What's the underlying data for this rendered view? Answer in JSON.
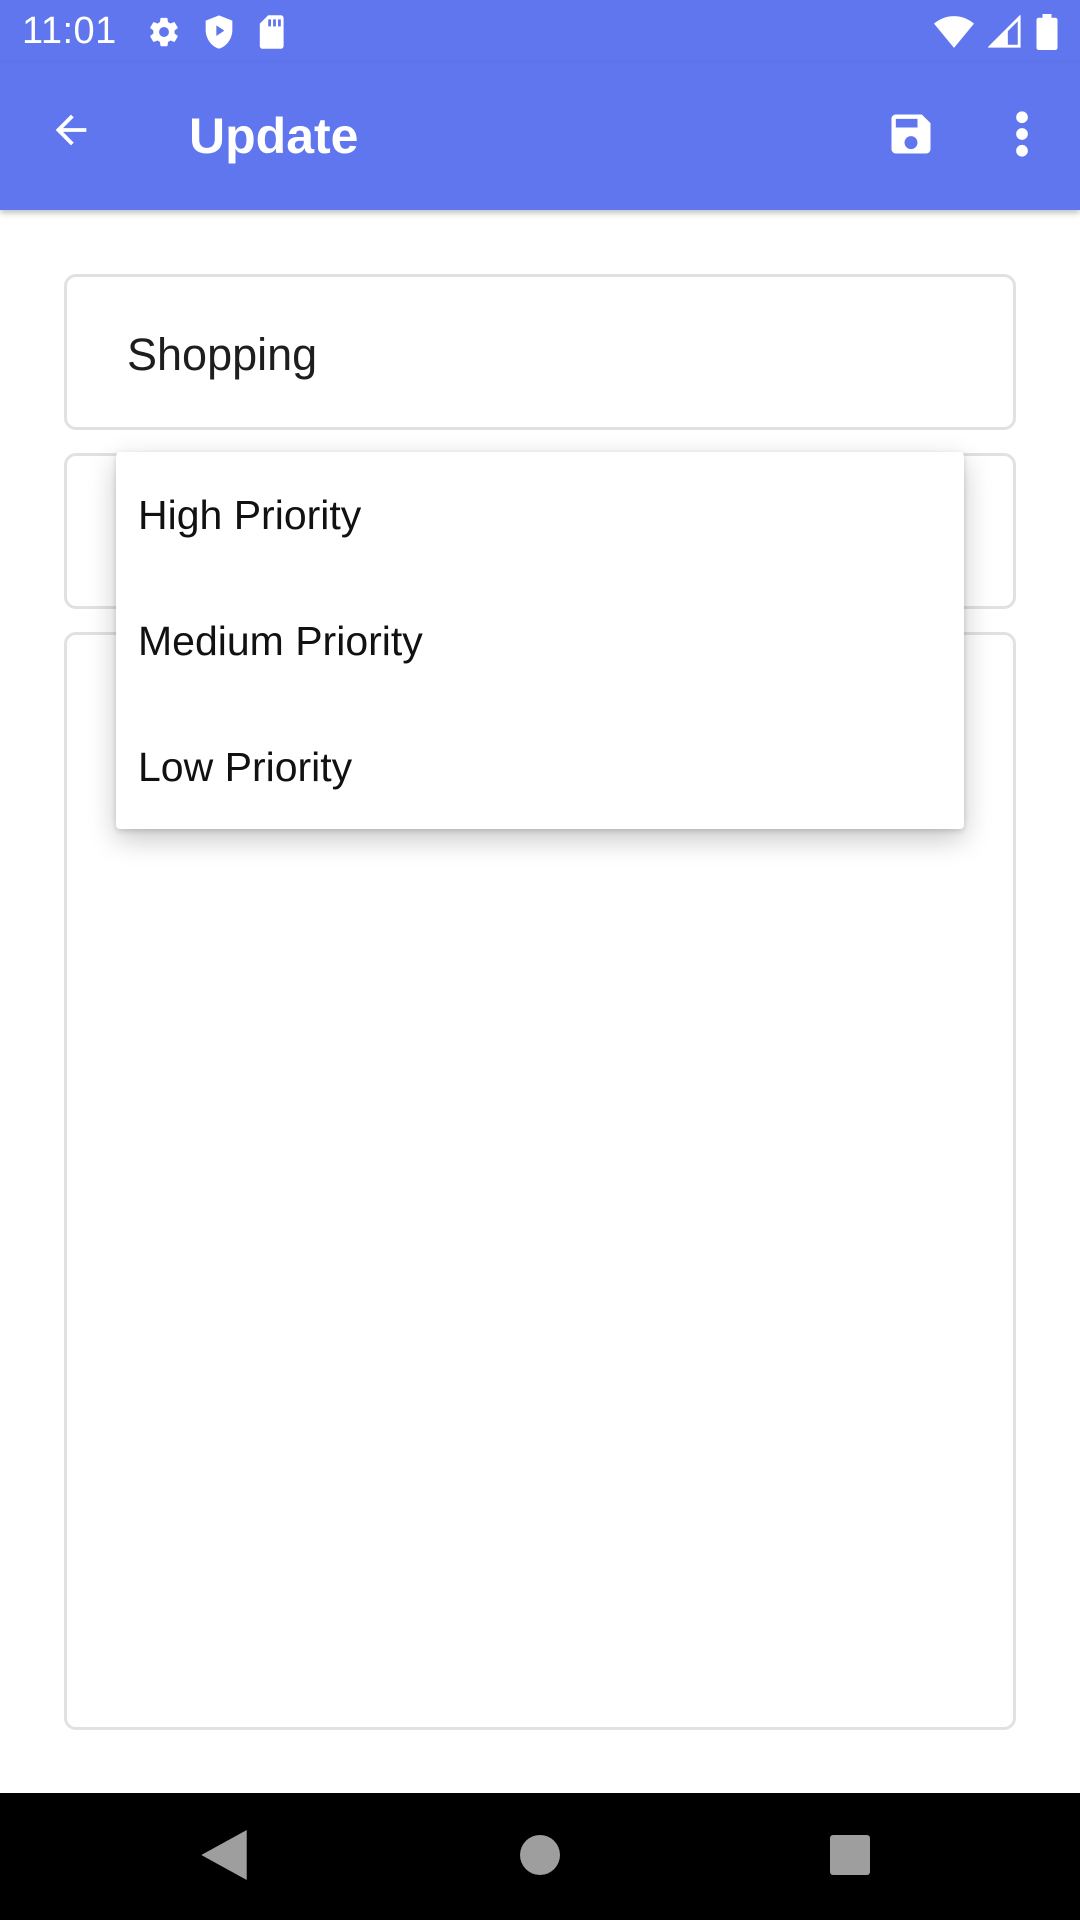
{
  "status_bar": {
    "time": "11:01",
    "icons": [
      "settings-icon",
      "shield-play-icon",
      "sd-card-icon",
      "wifi-icon",
      "signal-icon",
      "battery-icon"
    ]
  },
  "app_bar": {
    "title": "Update",
    "background_color": "#5f76ee",
    "icons": [
      "back-arrow-icon",
      "save-icon",
      "more-vert-icon"
    ]
  },
  "form": {
    "title_value": "Shopping",
    "priority_value": "",
    "description_value": ""
  },
  "dropdown": {
    "options": [
      {
        "label": "High Priority"
      },
      {
        "label": "Medium Priority"
      },
      {
        "label": "Low Priority"
      }
    ]
  },
  "nav_bar": {
    "icons": [
      "nav-back-icon",
      "nav-home-icon",
      "nav-recents-icon"
    ]
  }
}
